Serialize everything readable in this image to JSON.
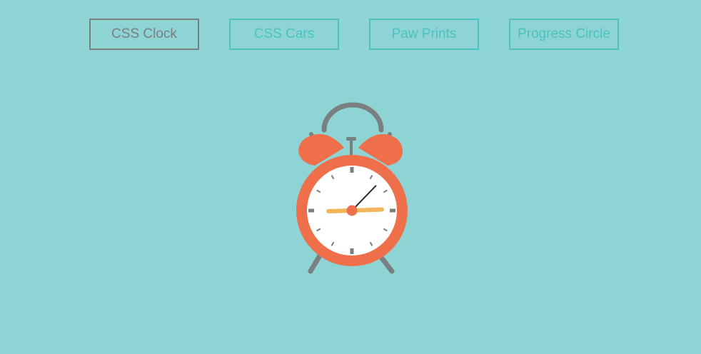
{
  "nav": {
    "items": [
      {
        "label": "CSS Clock",
        "active": true
      },
      {
        "label": "CSS Cars",
        "active": false
      },
      {
        "label": "Paw Prints",
        "active": false
      },
      {
        "label": "Progress Circle",
        "active": false
      }
    ]
  },
  "colors": {
    "background": "#8ed4d4",
    "button_border": "#4cc2c0",
    "button_active": "#7a7f80",
    "clock_body": "#ef6f4b",
    "clock_face": "#ffffff",
    "metal": "#7a7f80",
    "hour_hand": "#f2b55c",
    "minute_hand": "#2b2b2b"
  },
  "clock": {
    "hour_hand_angle_deg": 88,
    "minute_hand_angle_deg": 44
  }
}
